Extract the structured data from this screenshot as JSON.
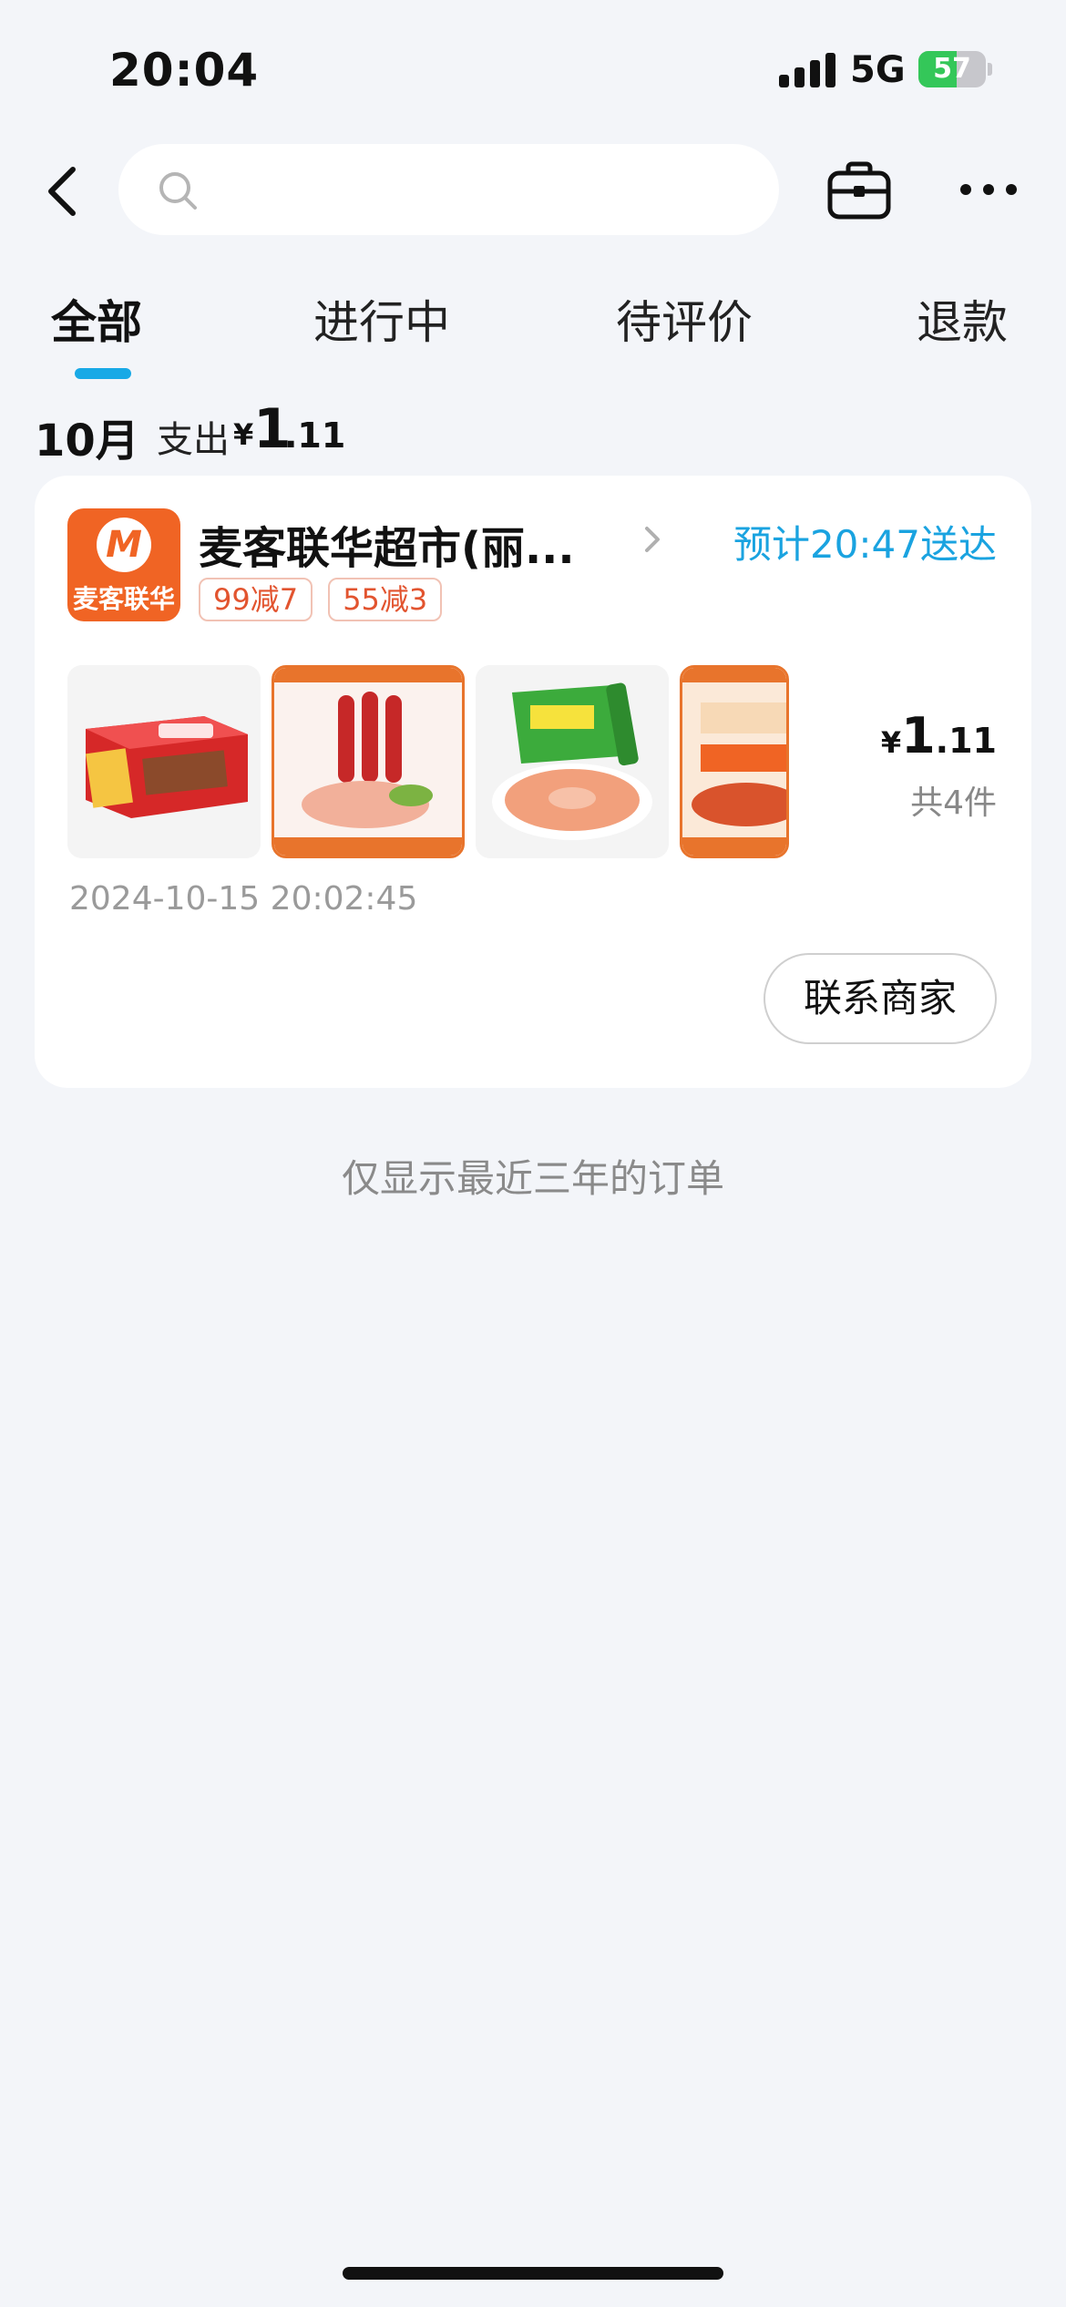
{
  "status_bar": {
    "time": "20:04",
    "network": "5G",
    "battery": "57",
    "battery_level": 0.57
  },
  "search": {
    "placeholder": ""
  },
  "tabs": [
    {
      "label": "全部",
      "active": true
    },
    {
      "label": "进行中",
      "active": false
    },
    {
      "label": "待评价",
      "active": false
    },
    {
      "label": "退款",
      "active": false
    }
  ],
  "summary": {
    "month": "10月",
    "spend_label": "支出",
    "currency": "¥",
    "amount_int": "1",
    "amount_dec": ".11"
  },
  "order": {
    "shop_logo_letter": "M",
    "shop_logo_text": "麦客联华",
    "shop_name": "麦客联华超市(丽...",
    "delivery": "预计20:47送达",
    "badges": [
      "99减7",
      "55减3"
    ],
    "products": [
      "nestle-ice-cream-box",
      "sausage-pack",
      "snack-chips-bag",
      "spicy-noodles"
    ],
    "price_currency": "¥",
    "price_int": "1",
    "price_dec": ".11",
    "item_count": "共4件",
    "time": "2024-10-15 20:02:45",
    "contact_label": "联系商家"
  },
  "footnote": "仅显示最近三年的订单",
  "colors": {
    "accent": "#18a9e6",
    "badge": "#e2542f",
    "logo": "#f06424",
    "background": "#f3f5f9"
  }
}
